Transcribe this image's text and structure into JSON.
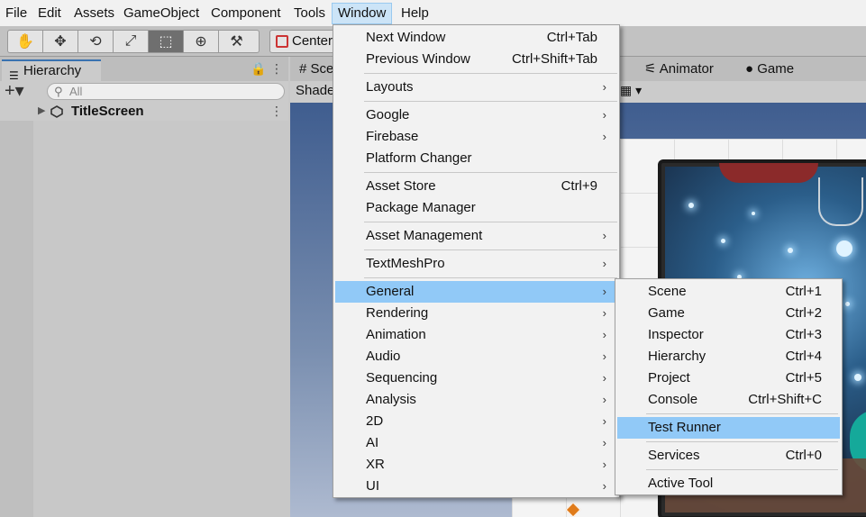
{
  "menubar": {
    "items": [
      "File",
      "Edit",
      "Assets",
      "GameObject",
      "Component",
      "Tools",
      "Window",
      "Help"
    ],
    "active": "Window"
  },
  "toolbar": {
    "tools": [
      "hand-tool-icon",
      "move-tool-icon",
      "rotate-tool-icon",
      "scale-tool-icon",
      "rect-tool-icon",
      "transform-tool-icon",
      "custom-tool-icon"
    ],
    "pivot_label": "Center"
  },
  "hierarchy": {
    "tab_label": "Hierarchy",
    "search_placeholder": "All",
    "scene_name": "TitleScreen"
  },
  "scene_tabs": {
    "scene_label": "Scene",
    "animator_label": "Animator",
    "game_label": "Game",
    "shading_label": "Shaded"
  },
  "window_menu": {
    "groups": [
      [
        {
          "label": "Next Window",
          "shortcut": "Ctrl+Tab"
        },
        {
          "label": "Previous Window",
          "shortcut": "Ctrl+Shift+Tab"
        }
      ],
      [
        {
          "label": "Layouts",
          "submenu": true
        }
      ],
      [
        {
          "label": "Google",
          "submenu": true
        },
        {
          "label": "Firebase",
          "submenu": true
        },
        {
          "label": "Platform Changer"
        }
      ],
      [
        {
          "label": "Asset Store",
          "shortcut": "Ctrl+9"
        },
        {
          "label": "Package Manager"
        }
      ],
      [
        {
          "label": "Asset Management",
          "submenu": true
        }
      ],
      [
        {
          "label": "TextMeshPro",
          "submenu": true
        }
      ],
      [
        {
          "label": "General",
          "submenu": true,
          "highlighted": true
        },
        {
          "label": "Rendering",
          "submenu": true
        },
        {
          "label": "Animation",
          "submenu": true
        },
        {
          "label": "Audio",
          "submenu": true
        },
        {
          "label": "Sequencing",
          "submenu": true
        },
        {
          "label": "Analysis",
          "submenu": true
        },
        {
          "label": "2D",
          "submenu": true
        },
        {
          "label": "AI",
          "submenu": true
        },
        {
          "label": "XR",
          "submenu": true
        },
        {
          "label": "UI",
          "submenu": true
        }
      ]
    ]
  },
  "general_submenu": {
    "groups": [
      [
        {
          "label": "Scene",
          "shortcut": "Ctrl+1"
        },
        {
          "label": "Game",
          "shortcut": "Ctrl+2"
        },
        {
          "label": "Inspector",
          "shortcut": "Ctrl+3"
        },
        {
          "label": "Hierarchy",
          "shortcut": "Ctrl+4"
        },
        {
          "label": "Project",
          "shortcut": "Ctrl+5"
        },
        {
          "label": "Console",
          "shortcut": "Ctrl+Shift+C"
        }
      ],
      [
        {
          "label": "Test Runner",
          "highlighted": true
        }
      ],
      [
        {
          "label": "Services",
          "shortcut": "Ctrl+0"
        }
      ],
      [
        {
          "label": "Active Tool"
        }
      ]
    ]
  }
}
